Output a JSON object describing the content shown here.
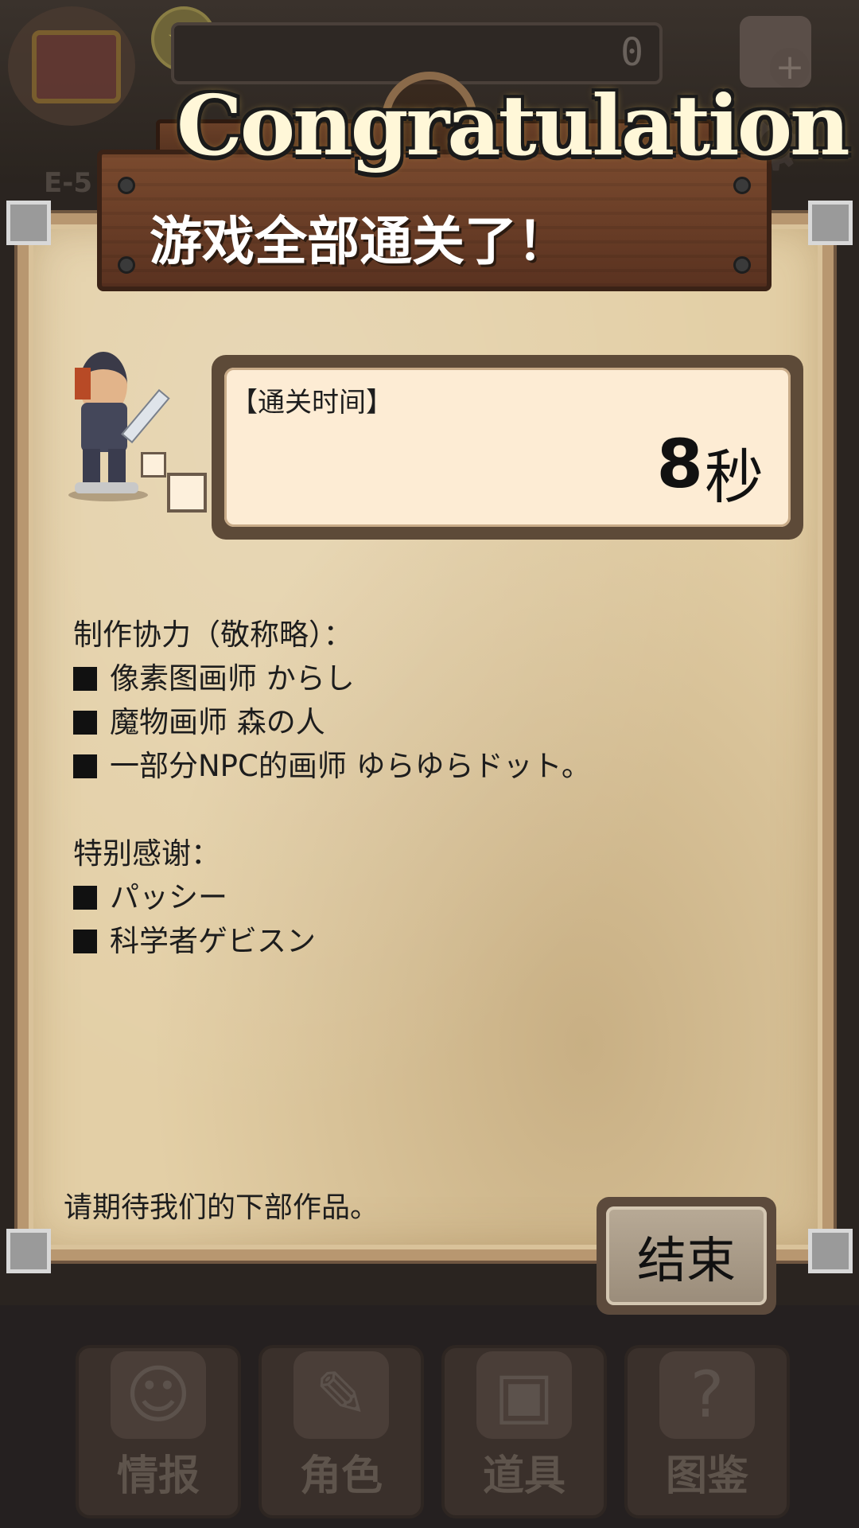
{
  "background": {
    "counter": "0",
    "level_label": "E-5",
    "tabs": [
      {
        "label": "情报",
        "icon": "info-icon"
      },
      {
        "label": "角色",
        "icon": "character-icon"
      },
      {
        "label": "道具",
        "icon": "chest-icon"
      },
      {
        "label": "图鉴",
        "icon": "book-icon"
      }
    ]
  },
  "dialog": {
    "banner": "Congratulation",
    "subtitle": "游戏全部通关了！",
    "clear_time": {
      "label": "【通关时间】",
      "value": "8",
      "unit": "秒"
    },
    "credits": {
      "heading": "制作协力（敬称略）：",
      "items": [
        "像素图画师 からし",
        "魔物画师 森の人",
        "一部分NPC的画师 ゆらゆらドット。"
      ],
      "thanks_heading": "特别感谢：",
      "thanks_items": [
        "パッシー",
        "科学者ゲビスン"
      ]
    },
    "footer": "请期待我们的下部作品。",
    "end_button": "结束"
  },
  "colors": {
    "parchment": "#e3cfa6",
    "wood": "#5a3220",
    "time_box_bg": "#fdecd4"
  }
}
